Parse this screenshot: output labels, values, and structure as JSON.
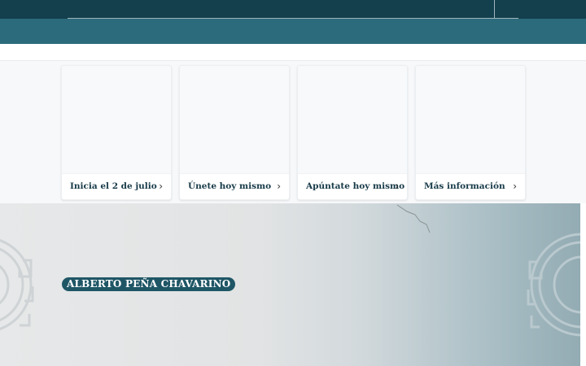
{
  "cards": [
    {
      "label": "Inicia el 2 de julio",
      "icon": "chevron-right-icon"
    },
    {
      "label": "Únete hoy mismo",
      "icon": "chevron-right-icon"
    },
    {
      "label": "Apúntate hoy mismo",
      "icon": "chevron-right-icon"
    },
    {
      "label": "Más información",
      "icon": "chevron-right-icon"
    }
  ],
  "hero": {
    "author_name": "ALBERTO PEÑA CHAVARINO"
  },
  "colors": {
    "topbar": "#143f4c",
    "band": "#2c6b7c",
    "badge": "#1f5666",
    "card_text": "#173a48"
  }
}
